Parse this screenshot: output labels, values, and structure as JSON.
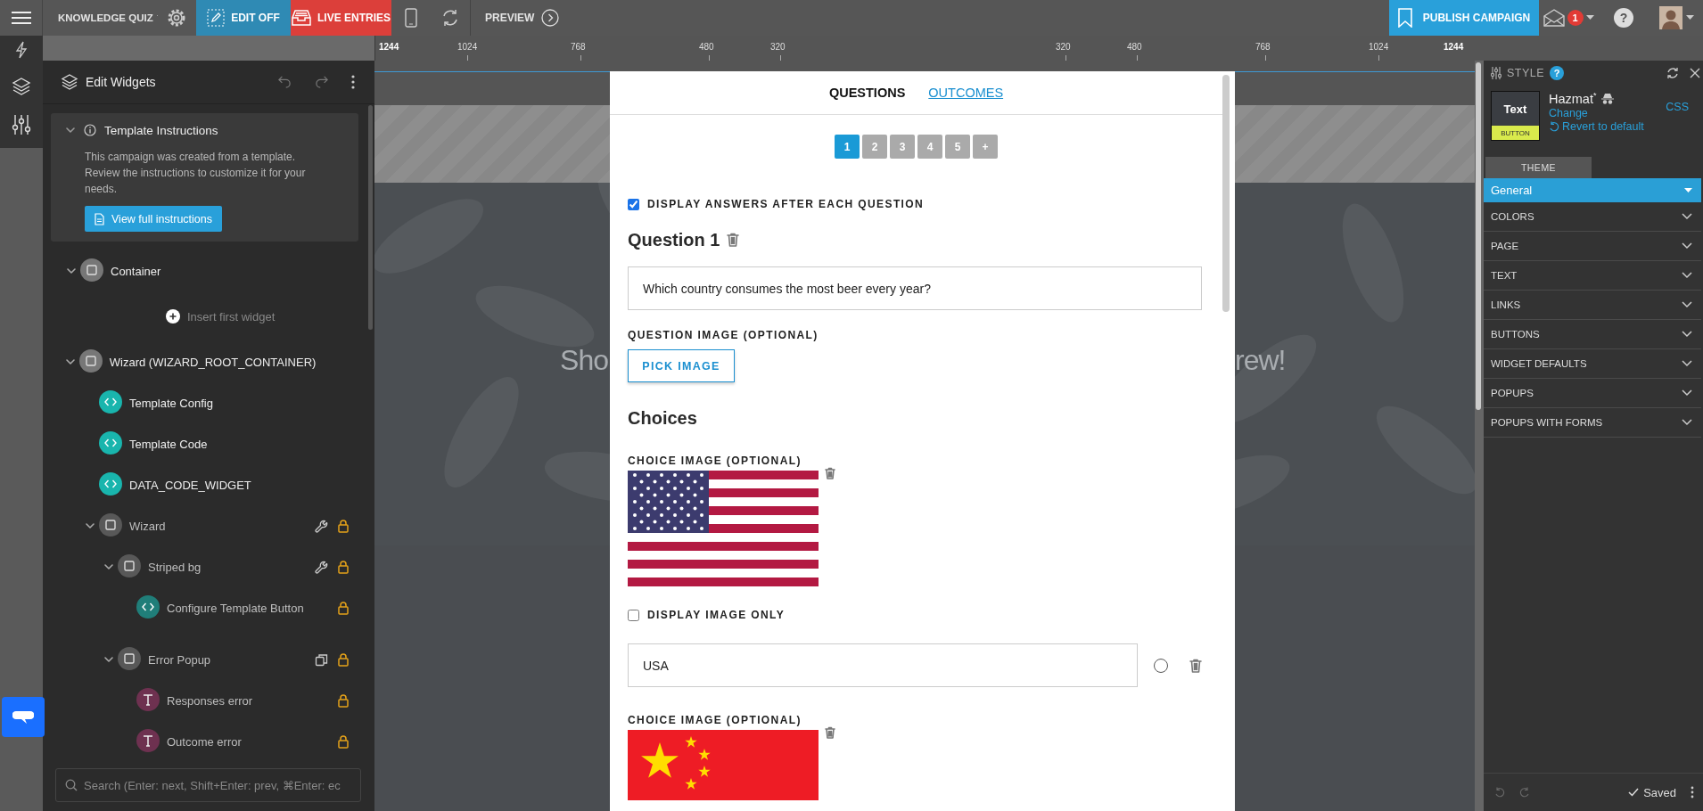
{
  "toolbar": {
    "campaign": "KNOWLEDGE QUIZ",
    "edit_mode": "EDIT OFF",
    "live_entries": "LIVE ENTRIES",
    "preview": "PREVIEW",
    "publish": "PUBLISH CAMPAIGN",
    "notification_count": "1",
    "help": "?"
  },
  "ruler": {
    "left_ticks": [
      "1244",
      "1024",
      "768",
      "480",
      "320"
    ],
    "right_ticks": [
      "320",
      "480",
      "768",
      "1024",
      "1244"
    ]
  },
  "widgets_panel": {
    "title": "Edit Widgets",
    "instructions": {
      "title": "Template Instructions",
      "expanded": true,
      "text": "This campaign was created from a template. Review the instructions to customize it for your needs.",
      "button": "View full instructions"
    },
    "tree": [
      {
        "label": "Container",
        "kind": "container",
        "expanded": true,
        "locked": false,
        "insert_label": "Insert first widget"
      },
      {
        "label": "Wizard (WIZARD_ROOT_CONTAINER)",
        "kind": "container",
        "expanded": true,
        "locked": false,
        "children": [
          {
            "label": "Template Config",
            "kind": "code",
            "locked": false
          },
          {
            "label": "Template Code",
            "kind": "code",
            "locked": false
          },
          {
            "label": "DATA_CODE_WIDGET",
            "kind": "code",
            "locked": false
          },
          {
            "label": "Wizard",
            "kind": "container",
            "expanded": true,
            "locked": true,
            "tool": {
              "kind": "settings"
            },
            "children": [
              {
                "label": "Striped bg",
                "kind": "container",
                "expanded": true,
                "locked": true,
                "tool": {
                  "kind": "settings"
                },
                "children": [
                  {
                    "label": "Configure Template Button",
                    "kind": "code",
                    "locked": true
                  }
                ]
              },
              {
                "label": "Error Popup",
                "kind": "container",
                "expanded": true,
                "locked": true,
                "tool": {
                  "kind": "duplicate"
                },
                "children": [
                  {
                    "label": "Responses error",
                    "kind": "text",
                    "locked": true
                  },
                  {
                    "label": "Outcome error",
                    "kind": "text",
                    "locked": true
                  }
                ]
              }
            ]
          }
        ]
      }
    ],
    "search": {
      "placeholder": "Search (Enter: next, Shift+Enter: prev, ⌘Enter: ec"
    }
  },
  "page_background": {
    "left_text": "Sho",
    "right_text": "rew!"
  },
  "quiz_editor": {
    "tabs": [
      {
        "label": "QUESTIONS",
        "selected": true
      },
      {
        "label": "OUTCOMES",
        "selected": false
      }
    ],
    "pages": [
      {
        "label": "1",
        "selected": true
      },
      {
        "label": "2",
        "selected": false
      },
      {
        "label": "3",
        "selected": false
      },
      {
        "label": "4",
        "selected": false
      },
      {
        "label": "5",
        "selected": false
      },
      {
        "label": "+",
        "selected": false
      }
    ],
    "display_answers": {
      "label": "DISPLAY ANSWERS AFTER EACH QUESTION",
      "checked": true
    },
    "question_title": "Question 1",
    "question_text": "Which country consumes the most beer every year?",
    "question_image_label": "QUESTION IMAGE (OPTIONAL)",
    "pick_image": "PICK IMAGE",
    "choices_title": "Choices",
    "choices": [
      {
        "image_label": "CHOICE IMAGE (OPTIONAL)",
        "image": {
          "kind": "us"
        },
        "display_image_only": {
          "label": "DISPLAY IMAGE ONLY",
          "checked": false
        },
        "answer": "USA",
        "correct": false
      },
      {
        "image_label": "CHOICE IMAGE (OPTIONAL)",
        "image": {
          "kind": "cn"
        }
      }
    ]
  },
  "style_panel": {
    "title": "STYLE",
    "help": "?",
    "preview": {
      "text": "Text",
      "button": "BUTTON"
    },
    "theme_name": "Hazmat$^{*}$",
    "change": "Change",
    "revert": "Revert to default",
    "css": "CSS",
    "tabs": [
      {
        "label": "THEME",
        "selected": true
      }
    ],
    "sections": [
      {
        "label": "General",
        "expanded": true
      },
      {
        "label": "COLORS",
        "expanded": false
      },
      {
        "label": "PAGE",
        "expanded": false
      },
      {
        "label": "TEXT",
        "expanded": false
      },
      {
        "label": "LINKS",
        "expanded": false
      },
      {
        "label": "BUTTONS",
        "expanded": false
      },
      {
        "label": "WIDGET DEFAULTS",
        "expanded": false
      },
      {
        "label": "POPUPS",
        "expanded": false
      },
      {
        "label": "POPUPS WITH FORMS",
        "expanded": false
      }
    ],
    "saved": "Saved"
  }
}
